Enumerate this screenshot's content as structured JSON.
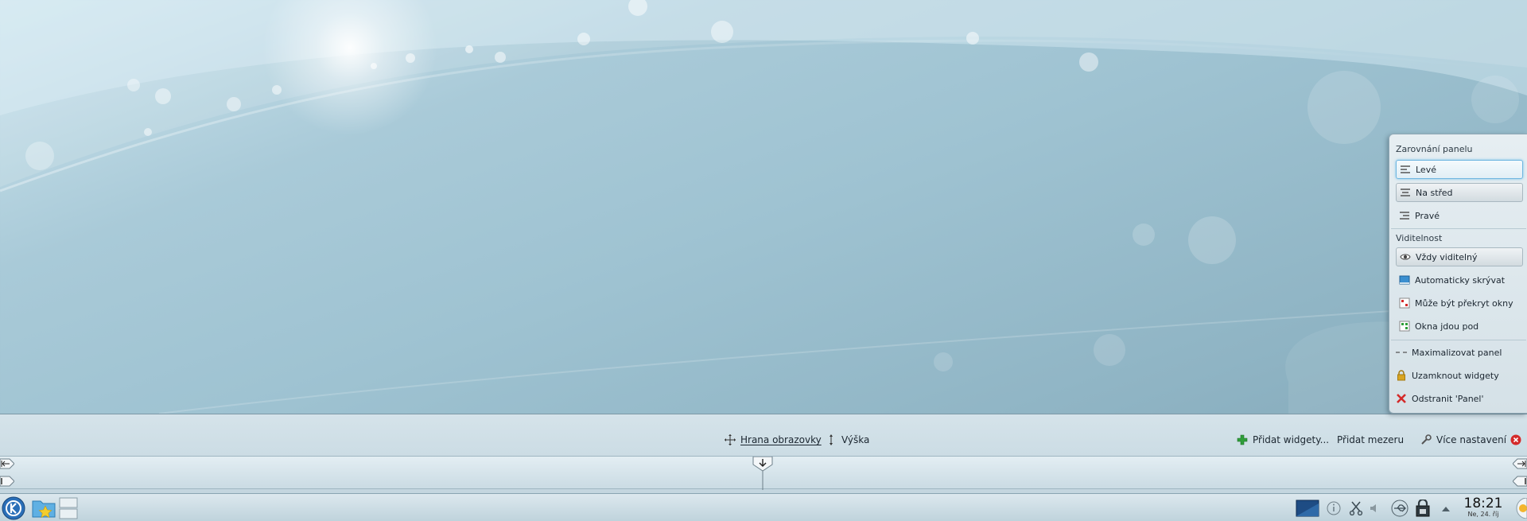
{
  "panel_controller": {
    "screen_edge_label": "Hrana obrazovky",
    "height_label": "Výška",
    "add_widgets_label": "Přidat widgety...",
    "add_spacer_label": "Přidat mezeru",
    "more_settings_label": "Více nastavení"
  },
  "context_menu": {
    "alignment_header": "Zarovnání panelu",
    "alignment_items": [
      {
        "label": "Levé",
        "state": "focused"
      },
      {
        "label": "Na střed",
        "state": "checked"
      },
      {
        "label": "Pravé",
        "state": "normal"
      }
    ],
    "visibility_header": "Viditelnost",
    "visibility_items": [
      {
        "label": "Vždy viditelný",
        "state": "checked"
      },
      {
        "label": "Automaticky skrývat",
        "state": "normal"
      },
      {
        "label": "Může být překryt okny",
        "state": "normal"
      },
      {
        "label": "Okna jdou pod",
        "state": "normal"
      }
    ],
    "action_items": [
      {
        "label": "Maximalizovat panel",
        "icon": "maximize-icon"
      },
      {
        "label": "Uzamknout widgety",
        "icon": "lock-icon"
      },
      {
        "label": "Odstranit 'Panel'",
        "icon": "remove-icon"
      }
    ]
  },
  "taskbar": {
    "clock_time": "18:21",
    "clock_date": "Ne, 24. říj"
  },
  "colors": {
    "accent": "#3a8fd0",
    "remove_red": "#d42a2a",
    "lock_gold": "#d9a521",
    "add_green": "#2f9e3a"
  }
}
